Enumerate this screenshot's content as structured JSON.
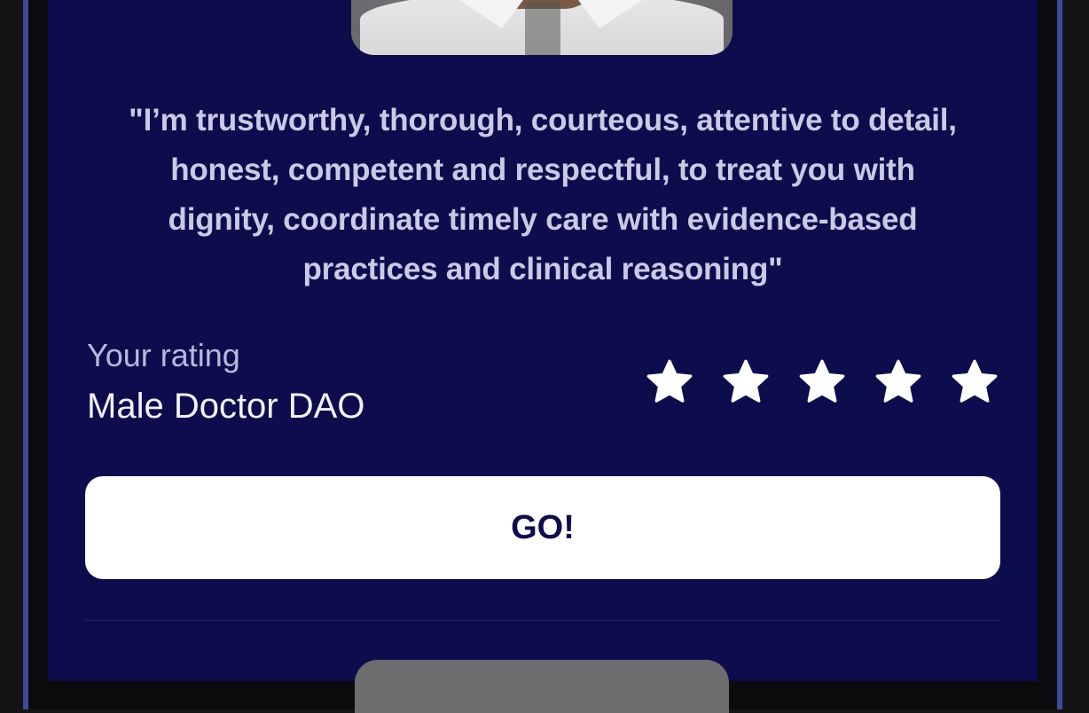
{
  "colors": {
    "screen_background": "#0d0d4d",
    "button_background": "#ffffff",
    "button_text": "#0d0d4d",
    "quote_text": "#c9cae6",
    "star_fill": "#ffffff"
  },
  "quote": {
    "text": "\"I’m trustworthy, thorough, courteous, attentive to detail, honest, competent and respectful, to treat you with dignity, coordinate timely care with evidence-based practices and clinical reasoning\""
  },
  "rating": {
    "label": "Your rating",
    "name": "Male Doctor DAO",
    "stars_total": 5,
    "stars_filled": 5
  },
  "actions": {
    "go_label": "GO!"
  },
  "icons": {
    "star": "star-icon"
  }
}
